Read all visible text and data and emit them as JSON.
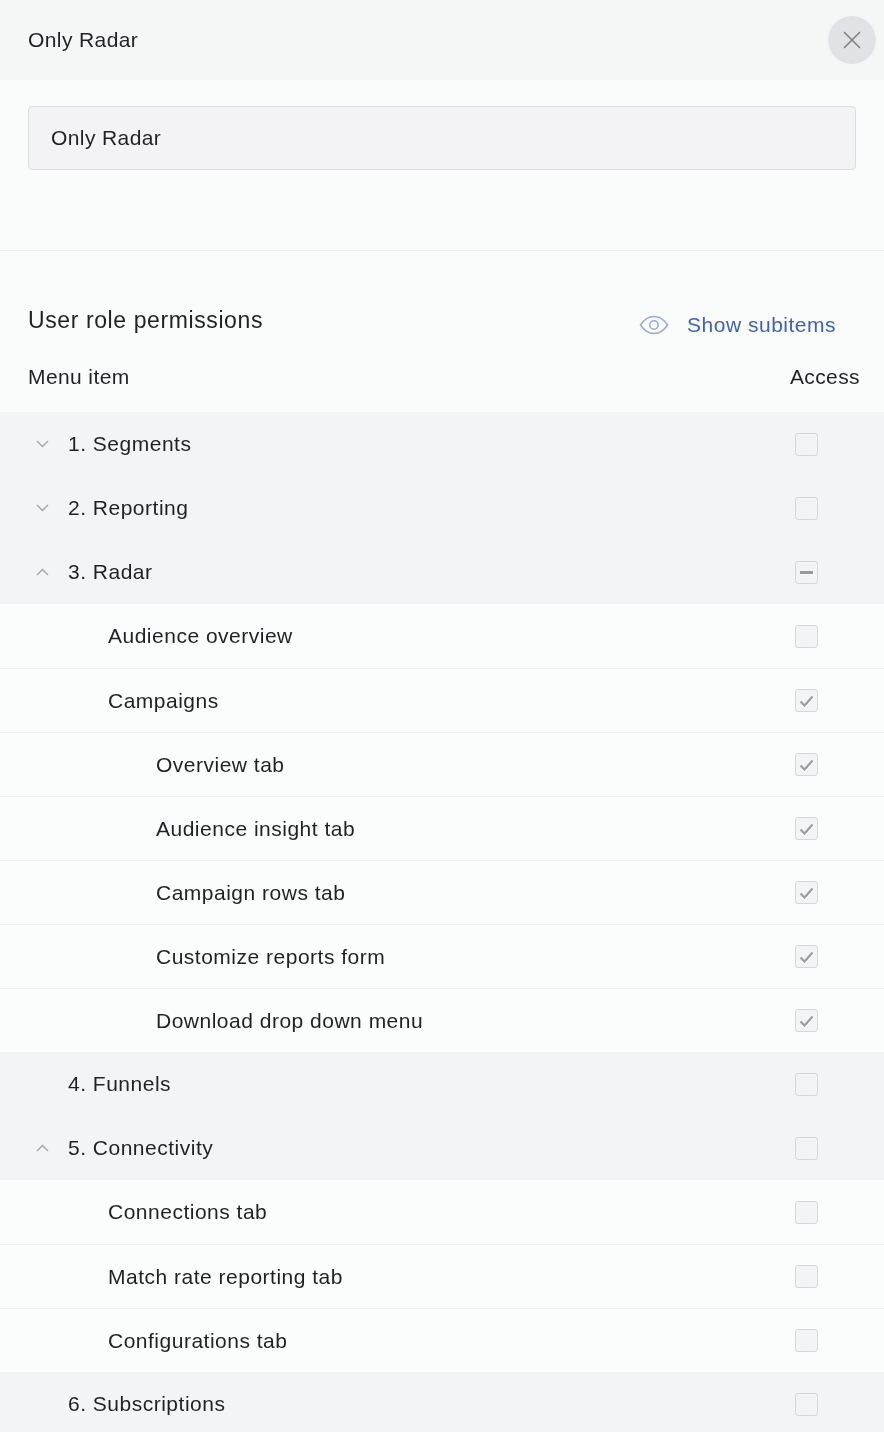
{
  "dialog": {
    "title": "Only Radar"
  },
  "role_name_field": {
    "value": "Only Radar"
  },
  "permissions": {
    "heading": "User role permissions",
    "show_subitems_link": "Show subitems",
    "columns": [
      "Menu item",
      "Access"
    ],
    "menu_items": [
      {
        "label": "1. Segments",
        "expanded": false,
        "checked": false,
        "partial": false
      },
      {
        "label": "2. Reporting",
        "expanded": false,
        "checked": false,
        "partial": false
      },
      {
        "label": "3. Radar",
        "expanded": true,
        "checked": false,
        "partial": true,
        "children": [
          {
            "label": "Audience overview",
            "checked": false,
            "partial": false
          },
          {
            "label": "Campaigns",
            "checked": true,
            "partial": false,
            "children": [
              {
                "label": "Overview tab",
                "checked": true,
                "partial": false
              },
              {
                "label": "Audience insight tab",
                "checked": true,
                "partial": false
              },
              {
                "label": "Campaign rows tab",
                "checked": true,
                "partial": false
              },
              {
                "label": "Customize reports form",
                "checked": true,
                "partial": false
              },
              {
                "label": "Download drop down menu",
                "checked": true,
                "partial": false
              }
            ]
          }
        ]
      },
      {
        "label": "4. Funnels",
        "checked": false,
        "partial": false
      },
      {
        "label": "5. Connectivity",
        "expanded": true,
        "checked": false,
        "partial": false,
        "children": [
          {
            "label": "Connections tab",
            "checked": false,
            "partial": false
          },
          {
            "label": "Match rate reporting tab",
            "checked": false,
            "partial": false
          },
          {
            "label": "Configurations tab",
            "checked": false,
            "partial": false
          }
        ]
      },
      {
        "label": "6. Subscriptions",
        "checked": false,
        "partial": false
      }
    ]
  }
}
